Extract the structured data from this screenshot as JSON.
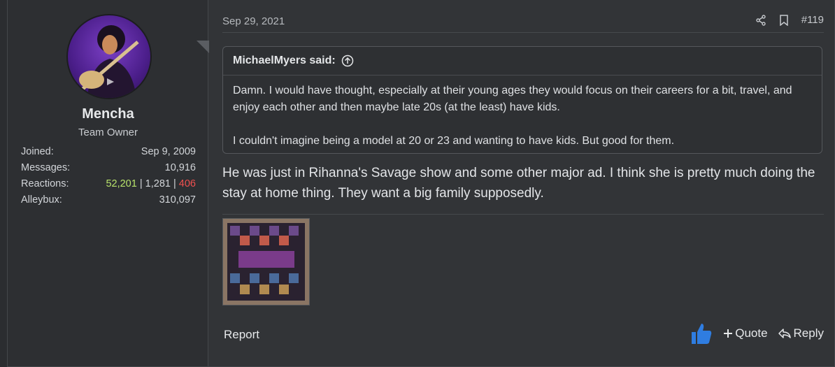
{
  "user": {
    "name": "Mencha",
    "title": "Team Owner",
    "stats": {
      "joined_label": "Joined:",
      "joined_value": "Sep 9, 2009",
      "messages_label": "Messages:",
      "messages_value": "10,916",
      "reactions_label": "Reactions:",
      "reactions_positive": "52,201",
      "reactions_sep1": "|",
      "reactions_neutral": "1,281",
      "reactions_sep2": "|",
      "reactions_negative": "406",
      "alleybux_label": "Alleybux:",
      "alleybux_value": "310,097"
    }
  },
  "post": {
    "date": "Sep 29, 2021",
    "number": "#119",
    "quote_author": "MichaelMyers said:",
    "quote_line1": "Damn. I would have thought, especially at their young ages they would focus on their careers for a bit, travel, and enjoy each other and then maybe late 20s (at the least) have kids.",
    "quote_line2": "I couldn't imagine being a model at 20 or 23 and wanting to have kids. But good for them.",
    "message": "He was just in Rihanna's Savage show and some other major ad. I think she is pretty much doing the stay at home thing. They want a big family supposedly."
  },
  "footer": {
    "report": "Report",
    "quote": "Quote",
    "reply": "Reply"
  },
  "icons": {
    "share": "share-icon",
    "bookmark": "bookmark-icon",
    "quote_jump": "arrow-up-circle-icon",
    "like": "thumbs-up-icon",
    "plus": "plus-icon",
    "reply": "reply-arrow-icon"
  },
  "colors": {
    "positive": "#b8e36b",
    "negative": "#f0504f",
    "like": "#2f7de1"
  }
}
